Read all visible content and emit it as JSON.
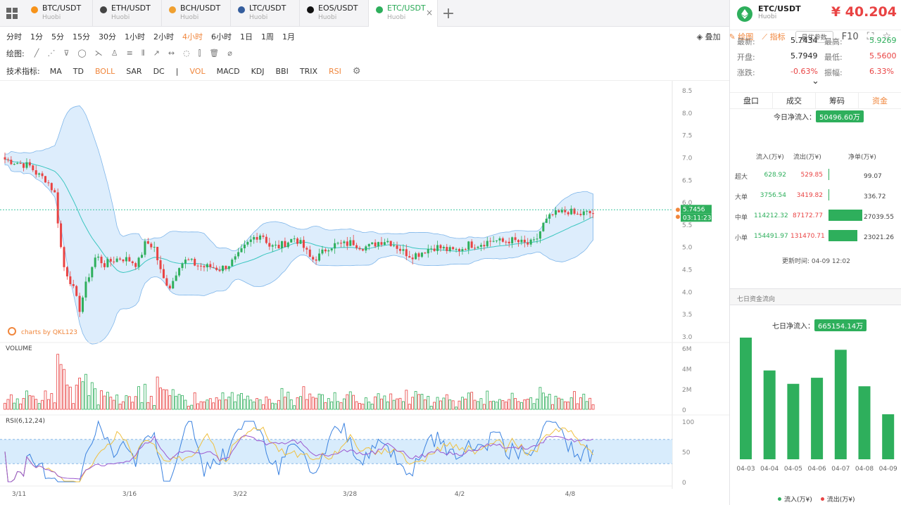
{
  "tabs": [
    {
      "pair": "BTC/USDT",
      "exchange": "Huobi",
      "color": "#f7931a",
      "active": false
    },
    {
      "pair": "ETH/USDT",
      "exchange": "Huobi",
      "color": "#444444",
      "active": false
    },
    {
      "pair": "BCH/USDT",
      "exchange": "Huobi",
      "color": "#f0a030",
      "active": false
    },
    {
      "pair": "LTC/USDT",
      "exchange": "Huobi",
      "color": "#345d9d",
      "active": false
    },
    {
      "pair": "EOS/USDT",
      "exchange": "Huobi",
      "color": "#111111",
      "active": false
    },
    {
      "pair": "ETC/USDT",
      "exchange": "Huobi",
      "color": "#2eaf5c",
      "active": true
    }
  ],
  "close_glyph": "×",
  "plus_glyph": "+",
  "periods": [
    "分时",
    "1分",
    "5分",
    "15分",
    "30分",
    "1小时",
    "2小时",
    "4小时",
    "6小时",
    "1日",
    "1周",
    "1月"
  ],
  "active_period": "4小时",
  "toolbar": {
    "overlay": "叠加",
    "draw": "绘图",
    "indicator": "指标",
    "best_params": "最优参数",
    "f10": "F10"
  },
  "draw_label": "绘图:",
  "draw_tools": [
    "╱",
    "⋰",
    "⊽",
    "◯",
    "⋋",
    "♙",
    "≡",
    "⦀",
    "↗",
    "↔",
    "◌",
    "⫿",
    "🗑",
    "⌀"
  ],
  "indicators_label": "技术指标:",
  "indicators": [
    "MA",
    "TD",
    "BOLL",
    "SAR",
    "DC",
    "|",
    "VOL",
    "MACD",
    "KDJ",
    "BBI",
    "TRIX",
    "RSI"
  ],
  "active_indicators": [
    "BOLL",
    "VOL",
    "RSI"
  ],
  "chart": {
    "price_ticks": [
      "8.5",
      "8.0",
      "7.5",
      "7.0",
      "6.5",
      "6.0",
      "5.5",
      "5.0",
      "4.5",
      "4.0",
      "3.5",
      "3.0"
    ],
    "volume_label": "VOLUME",
    "volume_ticks": [
      "6M",
      "4M",
      "2M",
      "0"
    ],
    "rsi_label": "RSI(6,12,24)",
    "rsi_ticks": [
      "100",
      "50",
      "0"
    ],
    "date_ticks": [
      "3/11",
      "3/16",
      "3/22",
      "3/28",
      "4/2",
      "4/8"
    ],
    "current_price": "5.7456",
    "countdown": "03:11:23",
    "watermark": "charts by QKL123"
  },
  "chart_data": {
    "type": "candlestick",
    "price_range": [
      3.0,
      8.5
    ],
    "close_path": [
      6.95,
      6.9,
      6.85,
      6.8,
      6.6,
      6.5,
      6.2,
      4.6,
      4.2,
      3.6,
      4.3,
      4.8,
      4.6,
      4.7,
      4.75,
      4.7,
      4.6,
      5.1,
      5.0,
      4.3,
      4.1,
      4.6,
      4.7,
      4.6,
      4.55,
      4.55,
      4.5,
      4.6,
      4.75,
      5.0,
      5.2,
      5.3,
      5.0,
      5.0,
      5.1,
      5.2,
      5.0,
      4.7,
      4.8,
      5.0,
      5.05,
      5.05,
      5.1,
      5.0,
      5.0,
      5.1,
      5.15,
      5.05,
      4.9,
      4.8,
      4.85,
      4.95,
      5.0,
      4.95,
      4.9,
      4.95,
      5.05,
      5.05,
      5.1,
      5.15,
      5.1,
      5.15,
      5.1,
      5.05,
      5.1,
      5.5,
      5.7,
      5.75,
      5.8,
      5.7,
      5.75,
      5.7456
    ]
  },
  "side": {
    "pair": "ETC/USDT",
    "exchange": "Huobi",
    "price": "¥ 40.204",
    "stats": [
      {
        "label": "最新:",
        "value": "5.7434",
        "color": "#222222"
      },
      {
        "label": "最高:",
        "value": "5.9269",
        "color": "#2eaf5c"
      },
      {
        "label": "开盘:",
        "value": "5.7949",
        "color": "#222222"
      },
      {
        "label": "最低:",
        "value": "5.5600",
        "color": "#e94343"
      },
      {
        "label": "涨跌:",
        "value": "-0.63%",
        "color": "#e94343"
      },
      {
        "label": "振幅:",
        "value": "6.33%",
        "color": "#e94343"
      }
    ],
    "expand": "⌄",
    "tabs": [
      "盘口",
      "成交",
      "筹码",
      "资金"
    ],
    "active_tab": "资金",
    "today_label": "今日净流入：",
    "today_value": "50496.60万",
    "flow_headers": [
      "流入(万¥)",
      "流出(万¥)",
      "净单(万¥)"
    ],
    "flow_rows": [
      {
        "name": "超大",
        "in": "628.92",
        "out": "529.85",
        "net": "99.07",
        "net_value": 99.07
      },
      {
        "name": "大单",
        "in": "3756.54",
        "out": "3419.82",
        "net": "336.72",
        "net_value": 336.72
      },
      {
        "name": "中单",
        "in": "114212.32",
        "out": "87172.77",
        "net": "27039.55",
        "net_value": 27039.55
      },
      {
        "name": "小单",
        "in": "154491.97",
        "out": "131470.71",
        "net": "23021.26",
        "net_value": 23021.26
      }
    ],
    "update_label": "更新时间:",
    "update_time": "04-09 12:02",
    "seven_title": "七日资金流向",
    "seven_label": "七日净流入：",
    "seven_value": "665154.14万",
    "legend_in": "流入(万¥)",
    "legend_out": "流出(万¥)"
  },
  "seven_chart_data": {
    "type": "bar",
    "categories": [
      "04-03",
      "04-04",
      "04-05",
      "04-06",
      "04-07",
      "04-08",
      "04-09"
    ],
    "values": [
      100,
      73,
      62,
      67,
      90,
      60,
      37
    ]
  }
}
